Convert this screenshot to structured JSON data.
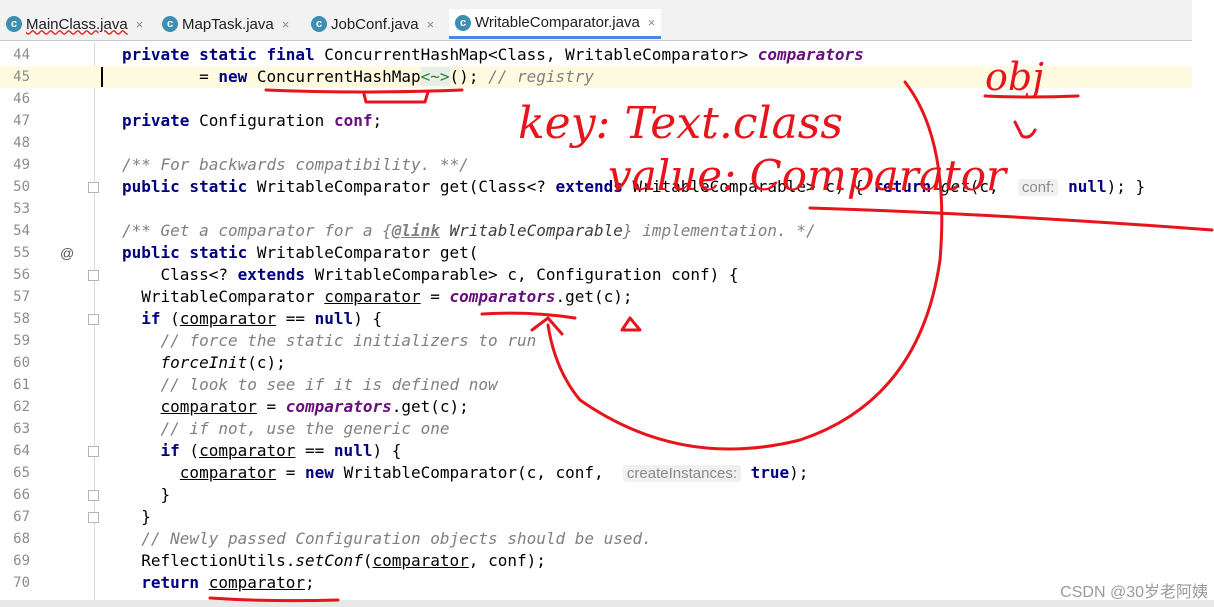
{
  "tabs": [
    {
      "label": "MainClass.java",
      "active": false,
      "squiggle": true
    },
    {
      "label": "MapTask.java",
      "active": false,
      "squiggle": false
    },
    {
      "label": "JobConf.java",
      "active": false,
      "squiggle": false
    },
    {
      "label": "WritableComparator.java",
      "active": true,
      "squiggle": false
    }
  ],
  "tab_close_glyph": "×",
  "file_icon_letter": "c",
  "lines": {
    "l44": {
      "num": "44",
      "kw": "private static final",
      "t1": " ConcurrentHashMap<Class, WritableComparator> ",
      "field": "comparators"
    },
    "l45": {
      "num": "45",
      "t0": "        = ",
      "kw": "new",
      "t1": " ",
      "cls": "ConcurrentHashMap",
      "diamond": "<~>",
      "t2": "(); ",
      "cm": "// registry"
    },
    "l46": {
      "num": "46"
    },
    "l47": {
      "num": "47",
      "kw": "private",
      "t1": " Configuration ",
      "field": "conf",
      "t2": ";"
    },
    "l48": {
      "num": "48"
    },
    "l49": {
      "num": "49",
      "cm": "/** For backwards compatibility. **/"
    },
    "l50": {
      "num": "50",
      "kw": "public static",
      "t1": " WritableComparator get(Class<? ",
      "kw2": "extends",
      "t2": " WritableComparable> c) { ",
      "kw3": "return",
      "t3": " ",
      "meth": "get",
      "t4": "(c,  ",
      "hint": "conf:",
      "t5": " ",
      "kw4": "null",
      "t6": "); }"
    },
    "l53": {
      "num": "53"
    },
    "l54": {
      "num": "54",
      "cm1": "/** Get a comparator for a {",
      "tag": "@link",
      "cm2": " WritableComparable",
      "cm3": "} implementation. */"
    },
    "l55": {
      "num": "55",
      "gicon": "@",
      "kw": "public static",
      "t1": " WritableComparator get("
    },
    "l56": {
      "num": "56",
      "t0": "    Class<? ",
      "kw": "extends",
      "t1": " WritableComparable> c, Configuration conf) {"
    },
    "l57": {
      "num": "57",
      "t0": "  WritableComparator ",
      "var": "comparator",
      "t1": " = ",
      "field": "comparators",
      "t2": ".get(c);"
    },
    "l58": {
      "num": "58",
      "t0": "  ",
      "kw": "if",
      "t1": " (",
      "var": "comparator",
      "t2": " == ",
      "kw2": "null",
      "t3": ") {"
    },
    "l59": {
      "num": "59",
      "t0": "    ",
      "cm": "// force the static initializers to run"
    },
    "l60": {
      "num": "60",
      "t0": "    ",
      "meth": "forceInit",
      "t1": "(c);"
    },
    "l61": {
      "num": "61",
      "t0": "    ",
      "cm": "// look to see if it is defined now"
    },
    "l62": {
      "num": "62",
      "t0": "    ",
      "var": "comparator",
      "t1": " = ",
      "field": "comparators",
      "t2": ".get(c);"
    },
    "l63": {
      "num": "63",
      "t0": "    ",
      "cm": "// if not, use the generic one"
    },
    "l64": {
      "num": "64",
      "t0": "    ",
      "kw": "if",
      "t1": " (",
      "var": "comparator",
      "t2": " == ",
      "kw2": "null",
      "t3": ") {"
    },
    "l65": {
      "num": "65",
      "t0": "      ",
      "var": "comparator",
      "t1": " = ",
      "kw": "new",
      "t2": " WritableComparator(c, conf,  ",
      "hint": "createInstances:",
      "t3": " ",
      "kw2": "true",
      "t4": ");"
    },
    "l66": {
      "num": "66",
      "t0": "    }"
    },
    "l67": {
      "num": "67",
      "t0": "  }"
    },
    "l68": {
      "num": "68",
      "t0": "  ",
      "cm": "// Newly passed Configuration objects should be used."
    },
    "l69": {
      "num": "69",
      "t0": "  ReflectionUtils.",
      "meth": "setConf",
      "t1": "(",
      "var": "comparator",
      "t2": ", conf);"
    },
    "l70": {
      "num": "70",
      "t0": "  ",
      "kw": "return",
      "t1": " ",
      "var": "comparator",
      "t2": ";"
    }
  },
  "handwriting": {
    "obj": "obj",
    "key": "key: Text.class",
    "value": "value: Comparator"
  },
  "watermark": "CSDN @30岁老阿姨",
  "colors": {
    "keyword": "#000080",
    "field": "#660e7a",
    "comment": "#808080",
    "annotation_ink": "#e8141b"
  }
}
